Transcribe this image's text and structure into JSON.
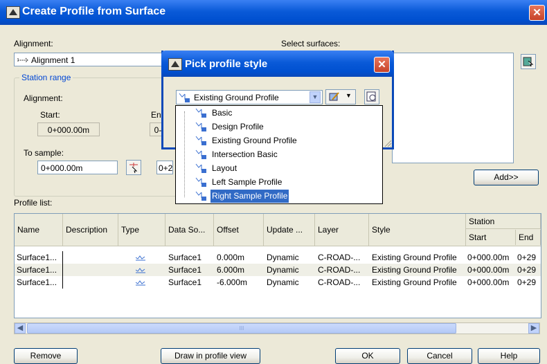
{
  "window": {
    "title": "Create Profile from Surface",
    "close_glyph": "✕"
  },
  "alignment": {
    "label": "Alignment:",
    "value": "Alignment 1"
  },
  "surfaces": {
    "label": "Select surfaces:"
  },
  "station_range": {
    "title": "Station range",
    "alignment_label": "Alignment:",
    "start_label": "Start:",
    "start_value": "0+000.00m",
    "end_label_partial": "End",
    "end_value_partial": "0-",
    "to_sample_label": "To sample:",
    "sample_start": "0+000.00m",
    "sample_end_partial": "0+2"
  },
  "add_button": "Add>>",
  "profile_list": {
    "label": "Profile list:",
    "columns": [
      "Name",
      "Description",
      "Type",
      "Data So...",
      "Offset",
      "Update ...",
      "Layer",
      "Style"
    ],
    "station_header": "Station",
    "station_sub": [
      "Start",
      "End"
    ],
    "rows": [
      {
        "name": "Surface1...",
        "desc": "",
        "data": "Surface1",
        "offset": "0.000m",
        "update": "Dynamic",
        "layer": "C-ROAD-...",
        "style": "Existing Ground Profile",
        "start": "0+000.00m",
        "end": "0+29"
      },
      {
        "name": "Surface1...",
        "desc": "",
        "data": "Surface1",
        "offset": "6.000m",
        "update": "Dynamic",
        "layer": "C-ROAD-...",
        "style": "Existing Ground Profile",
        "start": "0+000.00m",
        "end": "0+29"
      },
      {
        "name": "Surface1...",
        "desc": "",
        "data": "Surface1",
        "offset": "-6.000m",
        "update": "Dynamic",
        "layer": "C-ROAD-...",
        "style": "Existing Ground Profile",
        "start": "0+000.00m",
        "end": "0+29"
      }
    ],
    "scroll_thumb_glyph": "III"
  },
  "buttons": {
    "remove": "Remove",
    "draw": "Draw in profile view",
    "ok": "OK",
    "cancel": "Cancel",
    "help": "Help"
  },
  "popup": {
    "title": "Pick profile style",
    "close_glyph": "✕",
    "selected": "Existing Ground Profile",
    "items": [
      "Basic",
      "Design Profile",
      "Existing Ground Profile",
      "Intersection Basic",
      "Layout",
      "Left Sample Profile",
      "Right Sample Profile"
    ],
    "highlighted": "Right Sample Profile"
  },
  "colors": {
    "title_blue": "#0a5ad8",
    "selection": "#316ac5",
    "close_red": "#c6432a",
    "link_blue": "#0046d5"
  }
}
